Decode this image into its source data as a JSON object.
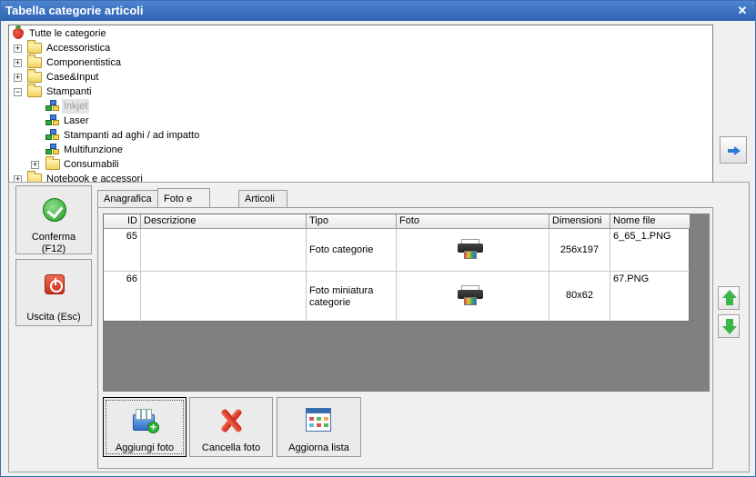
{
  "window": {
    "title": "Tabella categorie articoli"
  },
  "tree": {
    "root": "Tutte le categorie",
    "items": [
      {
        "label": "Accessoristica",
        "expander": "+"
      },
      {
        "label": "Componentistica",
        "expander": "+"
      },
      {
        "label": "Case&Input",
        "expander": "+"
      },
      {
        "label": "Stampanti",
        "expander": "−"
      },
      {
        "label": "Inkjet",
        "selected": true
      },
      {
        "label": "Laser"
      },
      {
        "label": "Stampanti ad aghi / ad impatto"
      },
      {
        "label": "Multifunzione"
      },
      {
        "label": "Consumabili",
        "expander": "+"
      },
      {
        "label": "Notebook e accessori",
        "expander": "+"
      }
    ]
  },
  "left_buttons": {
    "confirm": "Conferma\n(F12)",
    "exit": "Uscita (Esc)"
  },
  "tabs": [
    "Anagrafica",
    "Foto e immagini",
    "Articoli collegati"
  ],
  "active_tab": "Foto e immagini",
  "grid": {
    "columns": [
      "ID",
      "Descrizione",
      "Tipo",
      "Foto",
      "Dimensioni",
      "Nome file"
    ],
    "rows": [
      {
        "id": "65",
        "descrizione": "",
        "tipo": "Foto categorie",
        "foto": "printer-thumbnail",
        "dimensioni": "256x197",
        "nome_file": "6_65_1.PNG"
      },
      {
        "id": "66",
        "descrizione": "",
        "tipo": "Foto miniatura categorie",
        "foto": "printer-thumbnail",
        "dimensioni": "80x62",
        "nome_file": "67.PNG"
      }
    ]
  },
  "actions": {
    "add": "Aggiungi foto",
    "delete": "Cancella foto",
    "refresh": "Aggiorna lista"
  },
  "icons": {
    "close": "close-icon",
    "root": "strawberry-icon",
    "folder": "folder-icon",
    "category": "category-icon",
    "scroll_right": "arrow-right-icon",
    "move_up": "arrow-up-icon",
    "move_down": "arrow-down-icon"
  },
  "colors": {
    "titlebar": "#2d62b4",
    "grid_background": "#808080"
  }
}
